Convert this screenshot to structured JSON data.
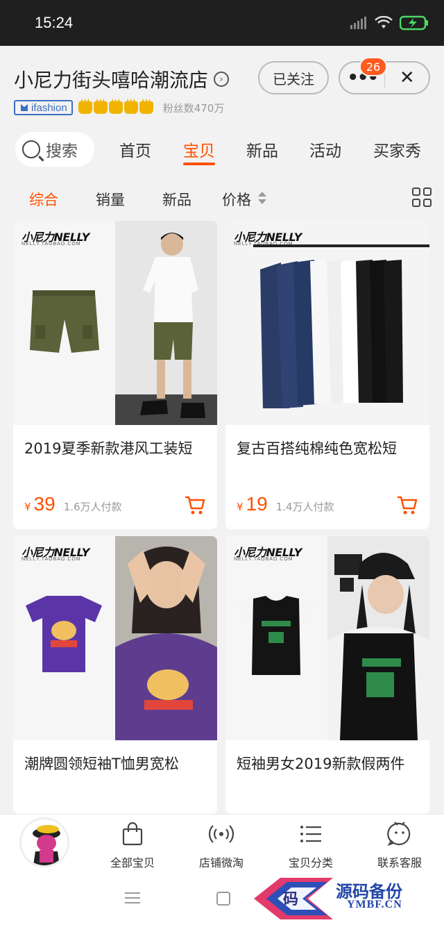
{
  "status_bar": {
    "time": "15:24",
    "icons": [
      "signal-icon",
      "wifi-icon",
      "battery-charging-icon"
    ]
  },
  "header": {
    "store_name": "小尼力街头嘻哈潮流店",
    "badge_ifashion": "ifashion",
    "crown_count": 5,
    "fans_text": "粉丝数470万",
    "follow_label": "已关注",
    "more_badge": "26",
    "close_glyph": "✕"
  },
  "nav": {
    "search_label": "搜索",
    "tabs": [
      {
        "label": "首页",
        "active": false
      },
      {
        "label": "宝贝",
        "active": true
      },
      {
        "label": "新品",
        "active": false
      },
      {
        "label": "活动",
        "active": false
      },
      {
        "label": "买家秀",
        "active": false
      }
    ]
  },
  "sort": {
    "options": [
      {
        "label": "综合",
        "active": true
      },
      {
        "label": "销量",
        "active": false
      },
      {
        "label": "新品",
        "active": false
      },
      {
        "label": "价格",
        "active": false
      }
    ]
  },
  "brand": {
    "logo": "小尼力NELLY",
    "sub": "NELLY.TAOBAO.COM"
  },
  "products": [
    {
      "title": "2019夏季新款港风工装短",
      "currency": "¥",
      "price": "39",
      "sold": "1.6万人付款"
    },
    {
      "title": "复古百搭纯棉纯色宽松短",
      "currency": "¥",
      "price": "19",
      "sold": "1.4万人付款"
    },
    {
      "title": "潮牌圆领短袖T恤男宽松",
      "currency": "",
      "price": "",
      "sold": ""
    },
    {
      "title": "短袖男女2019新款假两件",
      "currency": "",
      "price": "",
      "sold": ""
    }
  ],
  "bottom_bar": {
    "items": [
      {
        "label": "全部宝贝",
        "icon": "bag-icon"
      },
      {
        "label": "店铺微淘",
        "icon": "broadcast-icon"
      },
      {
        "label": "宝贝分类",
        "icon": "list-icon"
      },
      {
        "label": "联系客服",
        "icon": "chat-icon"
      }
    ]
  },
  "watermark": {
    "title": "源码备份",
    "url": "YMBF.CN",
    "logo_char": "码"
  },
  "colors": {
    "accent": "#ff5000",
    "status_bar": "#1f1f1f",
    "background": "#f2f2f2"
  }
}
